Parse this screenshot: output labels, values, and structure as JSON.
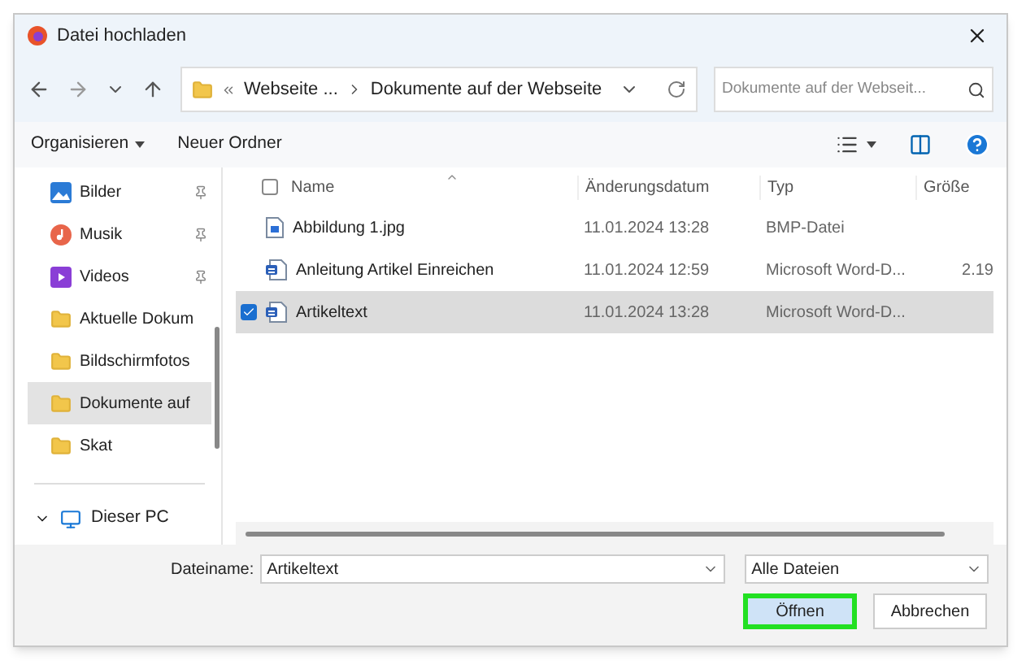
{
  "window": {
    "title": "Datei hochladen"
  },
  "nav": {
    "path": [
      "Webseite ...",
      "Dokumente auf der Webseite"
    ],
    "search": {
      "placeholder": "Dokumente auf der Webseit..."
    }
  },
  "toolbar": {
    "organize": "Organisieren",
    "new_folder": "Neuer Ordner"
  },
  "sidebar": {
    "items": [
      {
        "label": "Bilder",
        "kind": "pictures",
        "pinned": true,
        "selected": false
      },
      {
        "label": "Musik",
        "kind": "music",
        "pinned": true,
        "selected": false
      },
      {
        "label": "Videos",
        "kind": "video",
        "pinned": true,
        "selected": false
      },
      {
        "label": "Aktuelle Dokum",
        "kind": "folder",
        "pinned": false,
        "selected": false
      },
      {
        "label": "Bildschirmfotos",
        "kind": "folder",
        "pinned": false,
        "selected": false
      },
      {
        "label": "Dokumente auf",
        "kind": "folder",
        "pinned": false,
        "selected": true
      },
      {
        "label": "Skat",
        "kind": "folder",
        "pinned": false,
        "selected": false
      }
    ],
    "pc": {
      "label": "Dieser PC",
      "expanded": true
    }
  },
  "table": {
    "columns": [
      "Name",
      "Änderungsdatum",
      "Typ",
      "Größe"
    ],
    "all_selected": false,
    "rows": [
      {
        "name": "Abbildung 1.jpg",
        "kind": "image",
        "date": "11.01.2024 13:28",
        "type": "BMP-Datei",
        "size": "",
        "selected": false
      },
      {
        "name": "Anleitung Artikel Einreichen",
        "kind": "word",
        "date": "11.01.2024 12:59",
        "type": "Microsoft Word-D...",
        "size": "2.19",
        "selected": false
      },
      {
        "name": "Artikeltext",
        "kind": "word",
        "date": "11.01.2024 13:28",
        "type": "Microsoft Word-D...",
        "size": "",
        "selected": true
      }
    ]
  },
  "footer": {
    "filename_label": "Dateiname:",
    "filename": "Artikeltext",
    "filter": "Alle Dateien",
    "buttons": [
      {
        "label": "Öffnen",
        "focused": true
      },
      {
        "label": "Abbrechen",
        "focused": false
      }
    ]
  }
}
